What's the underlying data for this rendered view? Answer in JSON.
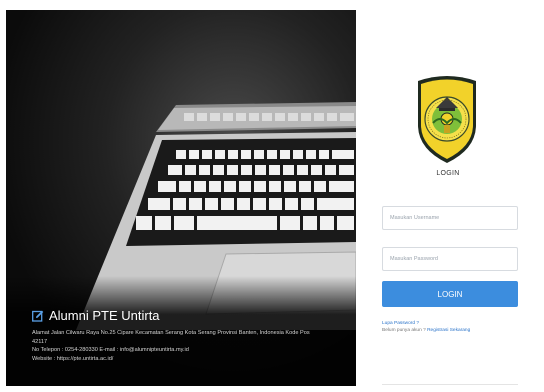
{
  "hero": {
    "title": "Alumni PTE Untirta",
    "lines": [
      "Alamat Jalan Cilwaru Raya No.25 Cipare Kecamatan Serang Kota Serang Provinsi Banten, Indonesia Kode Pos",
      "42117",
      "No Telepon : 0254-280330 E-mail : info@alumnipteuntirta.my.id",
      "Website : https://pte.untirta.ac.id/"
    ]
  },
  "login": {
    "title": "LOGIN",
    "username_placeholder": "Masukan Username",
    "password_placeholder": "Masukan Password",
    "button_label": "LOGIN",
    "forgot_label": "Lupa Password ?",
    "register_prompt": "Belum punya akun ? ",
    "register_link": "Registrasi Sekarang"
  },
  "colors": {
    "accent": "#3c8dde",
    "link": "#2a73c9"
  }
}
